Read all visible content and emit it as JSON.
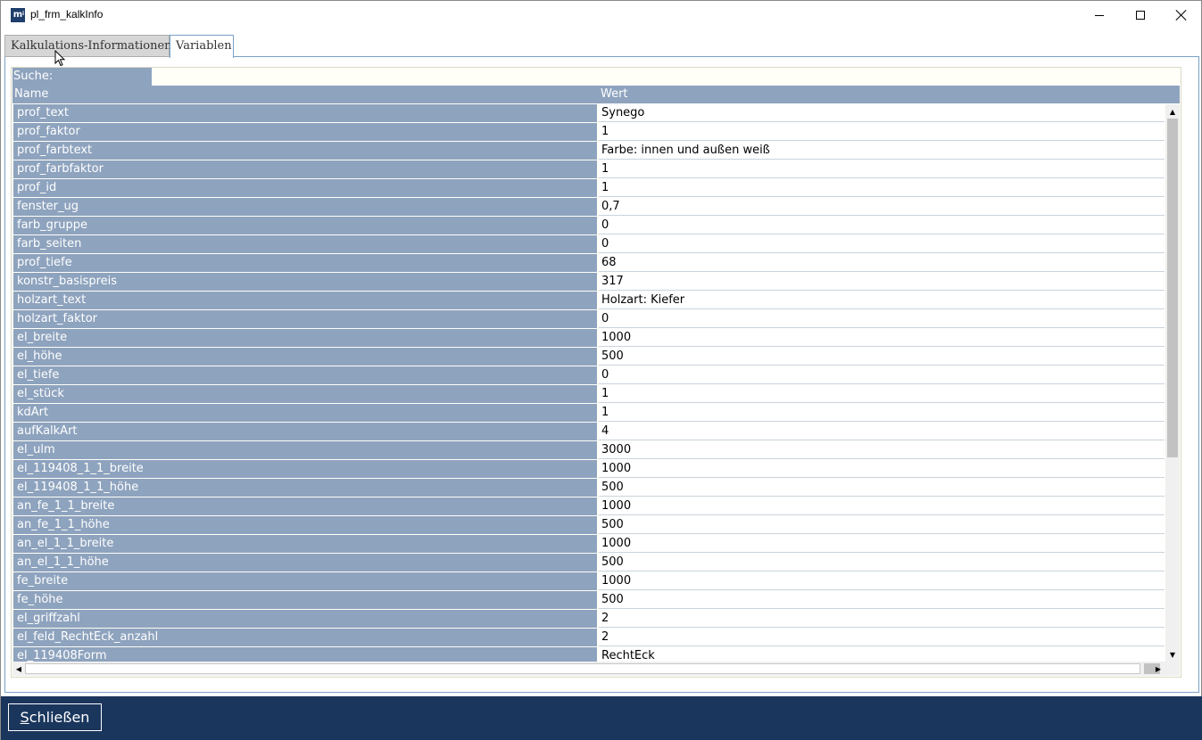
{
  "window": {
    "title": "pl_frm_kalkInfo",
    "icon": "app-logo-icon",
    "icon_text": "m"
  },
  "tabs": [
    {
      "label": "Kalkulations-Informationen",
      "selected": false
    },
    {
      "label": "Variablen",
      "selected": true
    }
  ],
  "search": {
    "label": "Suche:",
    "value": ""
  },
  "grid": {
    "columns": [
      "Name",
      "Wert"
    ],
    "rows": [
      {
        "name": "prof_text",
        "value": "Synego"
      },
      {
        "name": "prof_faktor",
        "value": "1"
      },
      {
        "name": "prof_farbtext",
        "value": "Farbe: innen und außen weiß"
      },
      {
        "name": "prof_farbfaktor",
        "value": "1"
      },
      {
        "name": "prof_id",
        "value": "1"
      },
      {
        "name": "fenster_ug",
        "value": "0,7"
      },
      {
        "name": "farb_gruppe",
        "value": "0"
      },
      {
        "name": "farb_seiten",
        "value": "0"
      },
      {
        "name": "prof_tiefe",
        "value": "68"
      },
      {
        "name": "konstr_basispreis",
        "value": "317"
      },
      {
        "name": "holzart_text",
        "value": "Holzart: Kiefer"
      },
      {
        "name": "holzart_faktor",
        "value": "0"
      },
      {
        "name": "el_breite",
        "value": "1000"
      },
      {
        "name": "el_höhe",
        "value": "500"
      },
      {
        "name": "el_tiefe",
        "value": "0"
      },
      {
        "name": "el_stück",
        "value": "1"
      },
      {
        "name": "kdArt",
        "value": "1"
      },
      {
        "name": "aufKalkArt",
        "value": "4"
      },
      {
        "name": "el_ulm",
        "value": "3000"
      },
      {
        "name": "el_119408_1_1_breite",
        "value": "1000"
      },
      {
        "name": "el_119408_1_1_höhe",
        "value": "500"
      },
      {
        "name": "an_fe_1_1_breite",
        "value": "1000"
      },
      {
        "name": "an_fe_1_1_höhe",
        "value": "500"
      },
      {
        "name": "an_el_1_1_breite",
        "value": "1000"
      },
      {
        "name": "an_el_1_1_höhe",
        "value": "500"
      },
      {
        "name": "fe_breite",
        "value": "1000"
      },
      {
        "name": "fe_höhe",
        "value": "500"
      },
      {
        "name": "el_griffzahl",
        "value": "2"
      },
      {
        "name": "el_feld_RechtEck_anzahl",
        "value": "2"
      },
      {
        "name": "el_119408Form",
        "value": "RechtEck"
      }
    ]
  },
  "footer": {
    "close_label_accel": "S",
    "close_label_rest": "chließen"
  },
  "colors": {
    "name_cell_bg": "#8ea3be",
    "footer_bg": "#1b365d"
  }
}
